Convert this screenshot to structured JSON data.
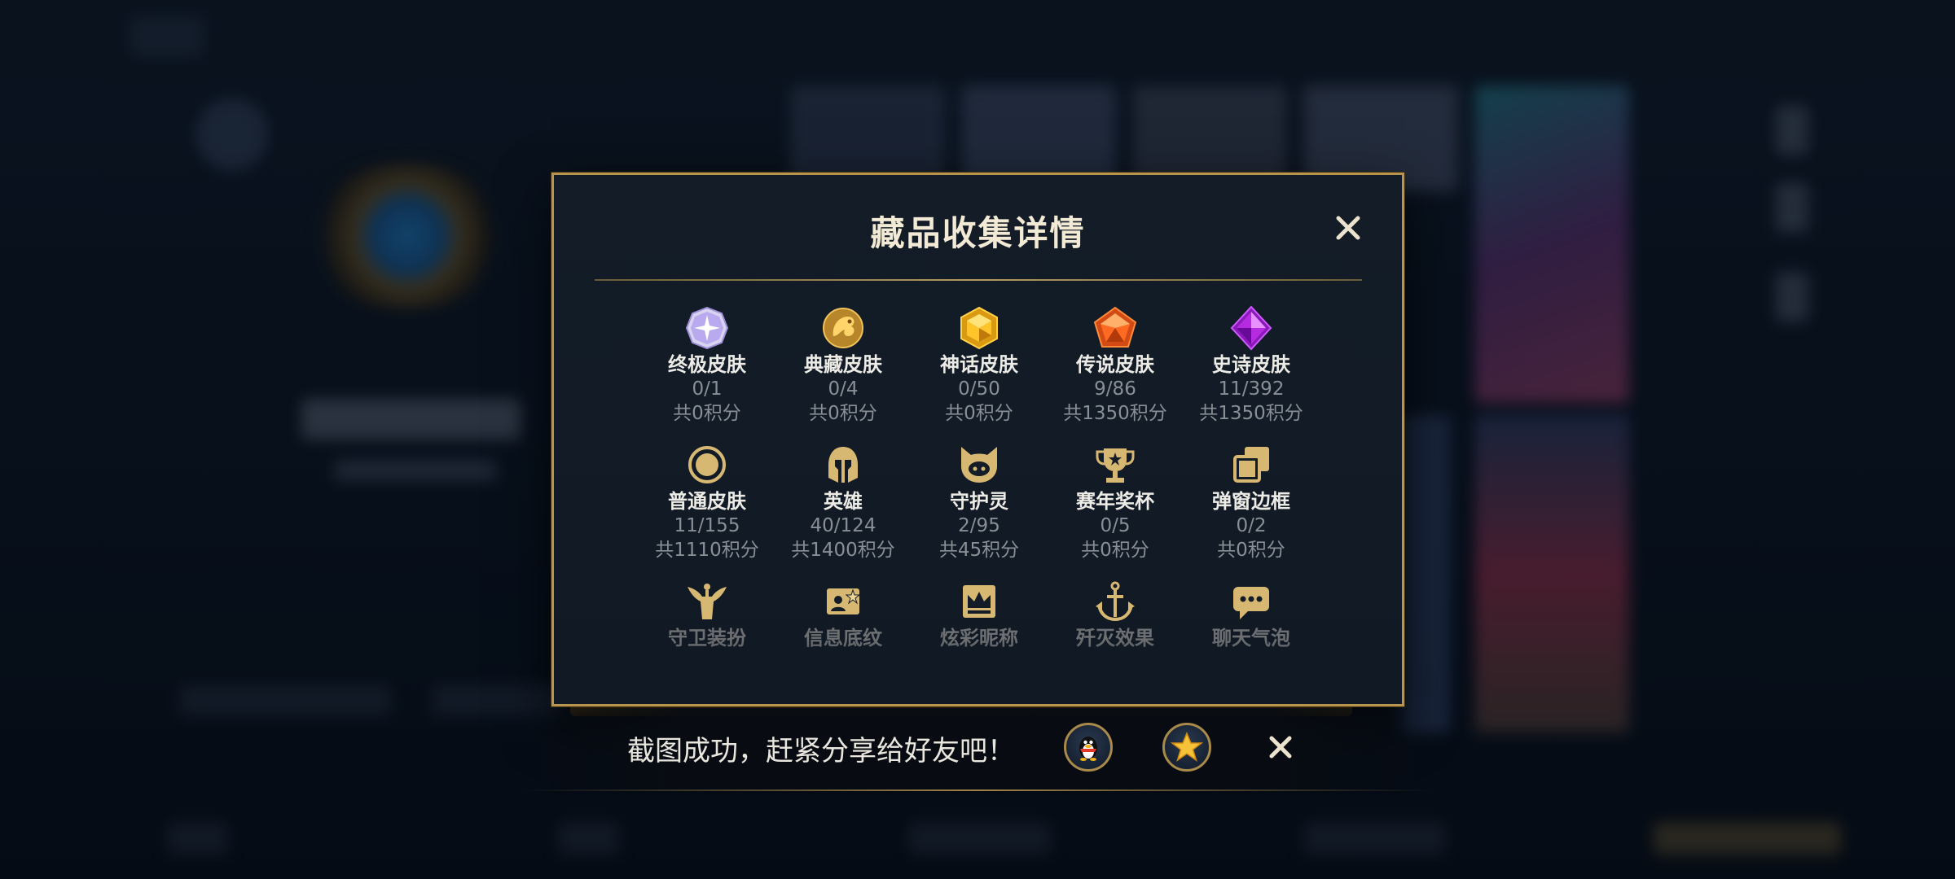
{
  "dialog": {
    "title": "藏品收集详情",
    "close_icon": "close-icon"
  },
  "collection": {
    "rows": [
      [
        {
          "id": "ultimate-skin",
          "name": "终极皮肤",
          "count": "0/1",
          "points": "共0积分",
          "icon": "ultimate-skin-icon"
        },
        {
          "id": "collector-skin",
          "name": "典藏皮肤",
          "count": "0/4",
          "points": "共0积分",
          "icon": "collector-skin-icon"
        },
        {
          "id": "mythic-skin",
          "name": "神话皮肤",
          "count": "0/50",
          "points": "共0积分",
          "icon": "mythic-skin-icon"
        },
        {
          "id": "legendary-skin",
          "name": "传说皮肤",
          "count": "9/86",
          "points": "共1350积分",
          "icon": "legendary-skin-icon"
        },
        {
          "id": "epic-skin",
          "name": "史诗皮肤",
          "count": "11/392",
          "points": "共1350积分",
          "icon": "epic-skin-icon"
        }
      ],
      [
        {
          "id": "normal-skin",
          "name": "普通皮肤",
          "count": "11/155",
          "points": "共1110积分",
          "icon": "normal-skin-icon"
        },
        {
          "id": "hero",
          "name": "英雄",
          "count": "40/124",
          "points": "共1400积分",
          "icon": "helmet-icon"
        },
        {
          "id": "guardian-spirit",
          "name": "守护灵",
          "count": "2/95",
          "points": "共45积分",
          "icon": "guardian-spirit-icon"
        },
        {
          "id": "season-trophy",
          "name": "赛年奖杯",
          "count": "0/5",
          "points": "共0积分",
          "icon": "trophy-icon"
        },
        {
          "id": "popup-frame",
          "name": "弹窗边框",
          "count": "0/2",
          "points": "共0积分",
          "icon": "stacked-frames-icon"
        }
      ],
      [
        {
          "id": "guard-outfit",
          "name": "守卫装扮",
          "icon": "guard-outfit-icon"
        },
        {
          "id": "info-background",
          "name": "信息底纹",
          "icon": "info-card-icon"
        },
        {
          "id": "flashy-nickname",
          "name": "炫彩昵称",
          "icon": "crown-card-icon"
        },
        {
          "id": "kill-effect",
          "name": "歼灭效果",
          "icon": "anchor-icon"
        },
        {
          "id": "chat-bubble",
          "name": "聊天气泡",
          "icon": "chat-bubble-icon"
        }
      ]
    ]
  },
  "toast": {
    "message": "截图成功，赶紧分享给好友吧！",
    "share_qq_icon": "qq-penguin-icon",
    "share_favorite_icon": "star-icon",
    "close_icon": "close-icon"
  },
  "colors": {
    "gold_border": "#b8944c",
    "title_text": "#f3ead6",
    "secondary_text": "#8a8e95",
    "icon_gold": "#d7b873"
  }
}
